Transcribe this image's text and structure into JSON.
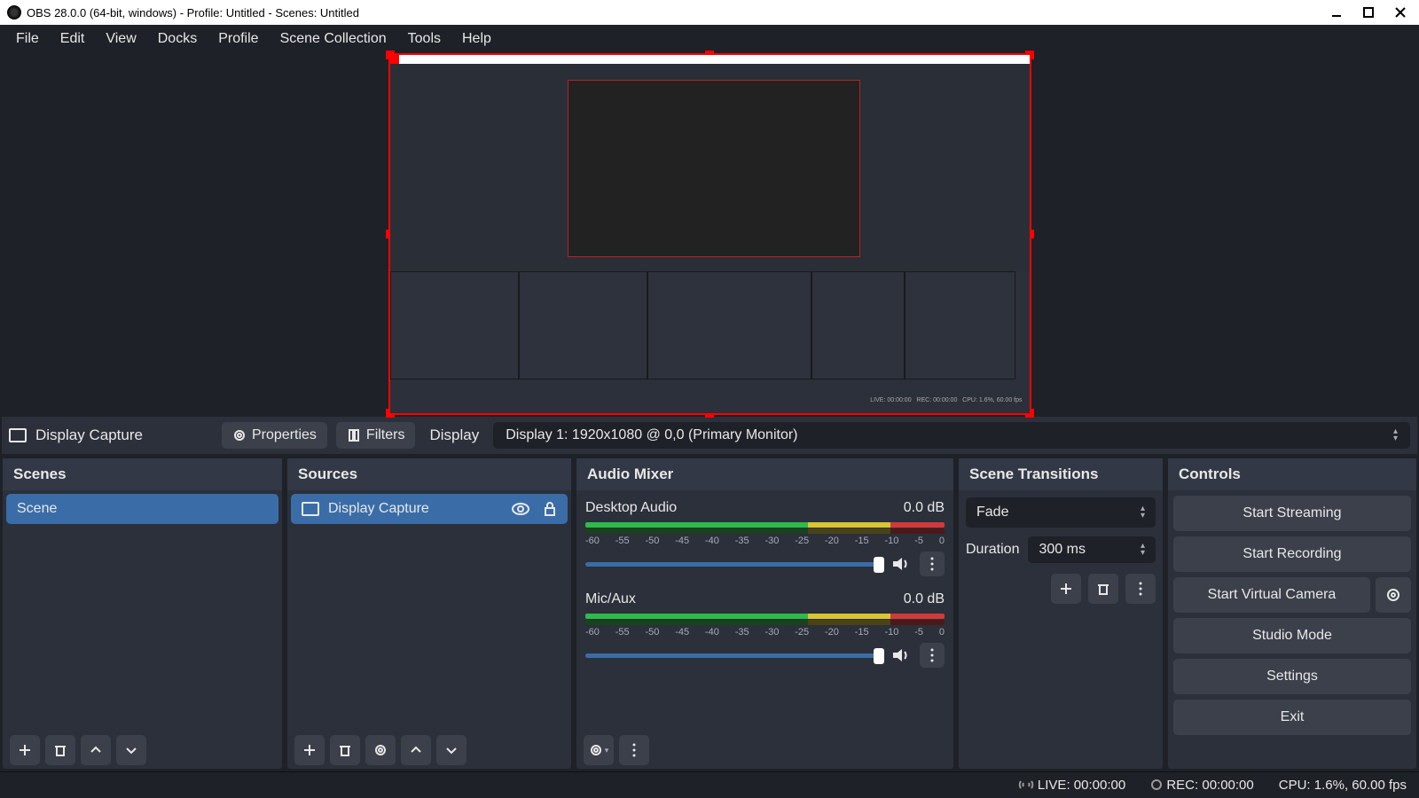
{
  "titlebar": {
    "title": "OBS 28.0.0 (64-bit, windows) - Profile: Untitled - Scenes: Untitled"
  },
  "menubar": [
    "File",
    "Edit",
    "View",
    "Docks",
    "Profile",
    "Scene Collection",
    "Tools",
    "Help"
  ],
  "source_info": {
    "name": "Display Capture",
    "properties_btn": "Properties",
    "filters_btn": "Filters",
    "display_label": "Display",
    "display_value": "Display 1: 1920x1080 @ 0,0 (Primary Monitor)"
  },
  "scenes": {
    "title": "Scenes",
    "items": [
      "Scene"
    ]
  },
  "sources": {
    "title": "Sources",
    "items": [
      {
        "name": "Display Capture"
      }
    ]
  },
  "mixer": {
    "title": "Audio Mixer",
    "channels": [
      {
        "name": "Desktop Audio",
        "db": "0.0 dB"
      },
      {
        "name": "Mic/Aux",
        "db": "0.0 dB"
      }
    ],
    "ticks": [
      "-60",
      "-55",
      "-50",
      "-45",
      "-40",
      "-35",
      "-30",
      "-25",
      "-20",
      "-15",
      "-10",
      "-5",
      "0"
    ]
  },
  "transitions": {
    "title": "Scene Transitions",
    "selected": "Fade",
    "duration_label": "Duration",
    "duration_value": "300 ms"
  },
  "controls": {
    "title": "Controls",
    "btns": {
      "streaming": "Start Streaming",
      "recording": "Start Recording",
      "vcam": "Start Virtual Camera",
      "studio": "Studio Mode",
      "settings": "Settings",
      "exit": "Exit"
    }
  },
  "statusbar": {
    "live": "LIVE: 00:00:00",
    "rec": "REC: 00:00:00",
    "cpu": "CPU: 1.6%, 60.00 fps"
  }
}
